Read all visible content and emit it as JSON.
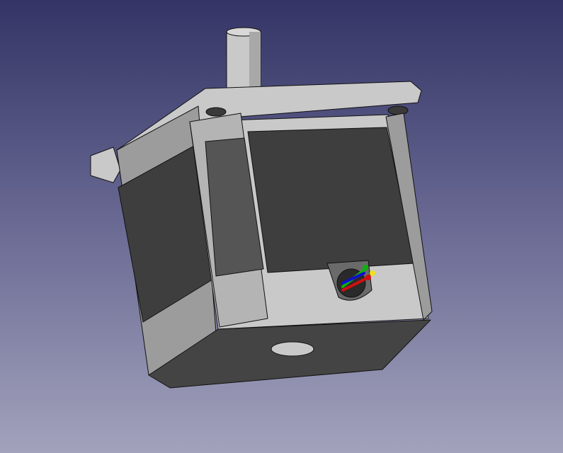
{
  "viewport": {
    "model": "stepper-motor",
    "background_top": "#343466",
    "background_bottom": "#a2a2bc",
    "colors": {
      "light": "#c9c9c9",
      "mid": "#9c9c9c",
      "dark": "#3e3e3e",
      "darker": "#2a2a2a",
      "axis_x": "#d01010",
      "axis_y": "#10b010",
      "axis_z": "#1010d0",
      "axis_origin": "#f0e020"
    }
  }
}
